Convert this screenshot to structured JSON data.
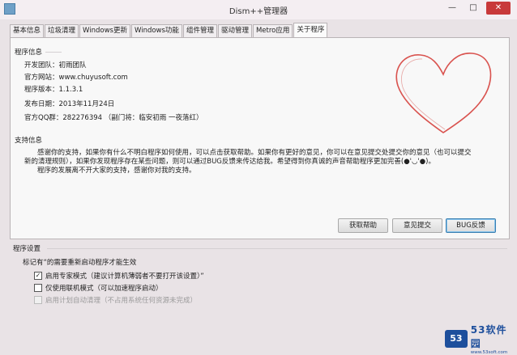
{
  "window": {
    "title": "Dism++管理器",
    "min_label": "—",
    "max_label": "□",
    "close_label": "✕"
  },
  "tabs": [
    {
      "label": "基本信息"
    },
    {
      "label": "垃圾清理"
    },
    {
      "label": "Windows更新"
    },
    {
      "label": "Windows功能"
    },
    {
      "label": "组件管理"
    },
    {
      "label": "驱动管理"
    },
    {
      "label": "Metro应用"
    },
    {
      "label": "关于程序",
      "active": true
    }
  ],
  "program_info": {
    "group_title": "程序信息",
    "rows": [
      {
        "label": "开发团队：",
        "value": "初雨团队"
      },
      {
        "label": "官方网站：",
        "value": "www.chuyusoft.com"
      },
      {
        "label": "程序版本：",
        "value": "1.1.3.1"
      },
      {
        "label": "发布日期：",
        "value": "2013年11月24日"
      },
      {
        "label": "官方QQ群：",
        "value": "282276394 （副门将：临安初雨 一夜落红）"
      }
    ]
  },
  "support": {
    "group_title": "支持信息",
    "lines": [
      "感谢你的支持，如果你有什么不明白程序如何使用，可以点击获取帮助。如果你有更好的意见，你可以在意见提交处提交你的意见（也可以提交",
      "新的清理规则），如果你发现程序存在某些问题，则可以通过BUG反馈来传达给我。希望得到你真诚的声音帮助程序更加完善(●'◡'●)。",
      "程序的发展离不开大家的支持，感谢你对我的支持。"
    ],
    "buttons": {
      "help": "获取帮助",
      "feedback": "意见提交",
      "bug": "BUG反馈"
    }
  },
  "settings": {
    "group_title": "程序设置",
    "hint": "标记有“的需要重新启动程序才能生效",
    "options": [
      {
        "label": "启用专家模式（建议计算机薄弱者不要打开该设置）”",
        "checked": true,
        "enabled": true
      },
      {
        "label": "仅使用联机模式（可以加速程序启动）",
        "checked": false,
        "enabled": true
      },
      {
        "label": "启用计划自动清理（不占用系统任何资源未完成）",
        "checked": false,
        "enabled": false
      }
    ]
  },
  "watermark": {
    "logo": "53",
    "name": "53软件园",
    "url": "www.53soft.com"
  },
  "colors": {
    "heart": "#d9534f",
    "close": "#c8393a",
    "accent": "#1e4f9c"
  }
}
